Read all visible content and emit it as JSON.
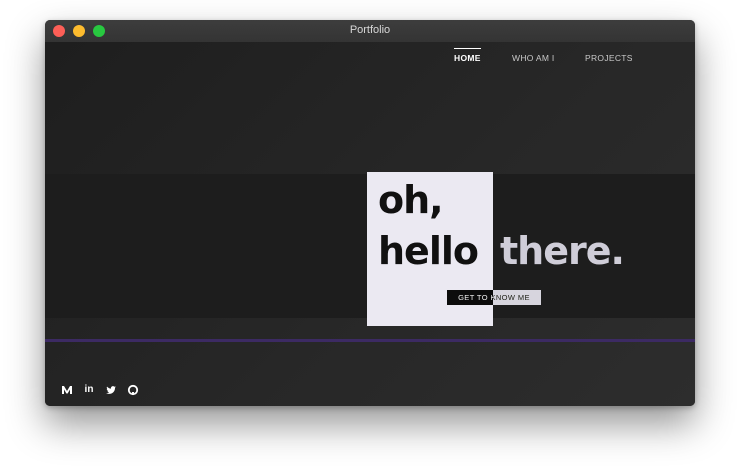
{
  "window": {
    "title": "Portfolio"
  },
  "nav": {
    "items": [
      {
        "label": "HOME",
        "active": true
      },
      {
        "label": "WHO AM I",
        "active": false
      },
      {
        "label": "PROJECTS",
        "active": false
      }
    ]
  },
  "hero": {
    "line1": "oh,",
    "line2_dark": "hello",
    "line2_light": "there.",
    "cta_label": "GET TO KNOW ME"
  },
  "social": {
    "icons": [
      "medium-icon",
      "linkedin-icon",
      "twitter-icon",
      "github-icon"
    ],
    "linkedin_text": "in"
  },
  "colors": {
    "background": "#252525",
    "band": "#1d1d1d",
    "card": "#ebe9f2",
    "accent_line": "#3c2a63",
    "text_light": "#cfcdd8"
  }
}
